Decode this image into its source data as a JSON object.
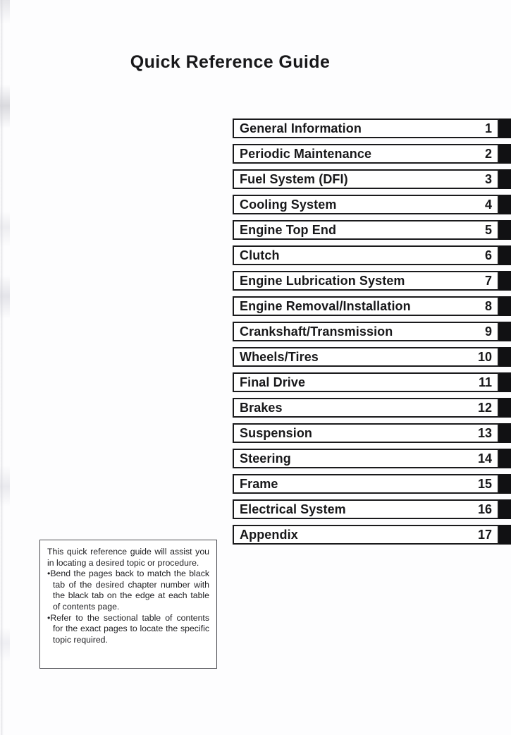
{
  "document": {
    "title": "Quick Reference Guide"
  },
  "chapters": [
    {
      "title": "General Information",
      "number": "1"
    },
    {
      "title": "Periodic Maintenance",
      "number": "2"
    },
    {
      "title": "Fuel System (DFI)",
      "number": "3"
    },
    {
      "title": "Cooling System",
      "number": "4"
    },
    {
      "title": "Engine Top End",
      "number": "5"
    },
    {
      "title": "Clutch",
      "number": "6"
    },
    {
      "title": "Engine Lubrication System",
      "number": "7"
    },
    {
      "title": "Engine Removal/Installation",
      "number": "8"
    },
    {
      "title": "Crankshaft/Transmission",
      "number": "9"
    },
    {
      "title": "Wheels/Tires",
      "number": "10"
    },
    {
      "title": "Final Drive",
      "number": "11"
    },
    {
      "title": "Brakes",
      "number": "12"
    },
    {
      "title": "Suspension",
      "number": "13"
    },
    {
      "title": "Steering",
      "number": "14"
    },
    {
      "title": "Frame",
      "number": "15"
    },
    {
      "title": "Electrical System",
      "number": "16"
    },
    {
      "title": "Appendix",
      "number": "17"
    }
  ],
  "note": {
    "intro": "This quick reference guide will assist you in locating a desired topic or procedure.",
    "bullet_1": "Bend the pages back to match the black tab of the desired chapter number with the black tab on the edge at each table of contents page.",
    "bullet_2": "Refer to the sectional table of contents for the exact pages to locate the specific topic required.",
    "bullet_marker": "•"
  },
  "colors": {
    "ink": "#18181a",
    "tab_black": "#111113",
    "page_background": "#fdfdfe",
    "note_border": "#4a4a4f"
  }
}
